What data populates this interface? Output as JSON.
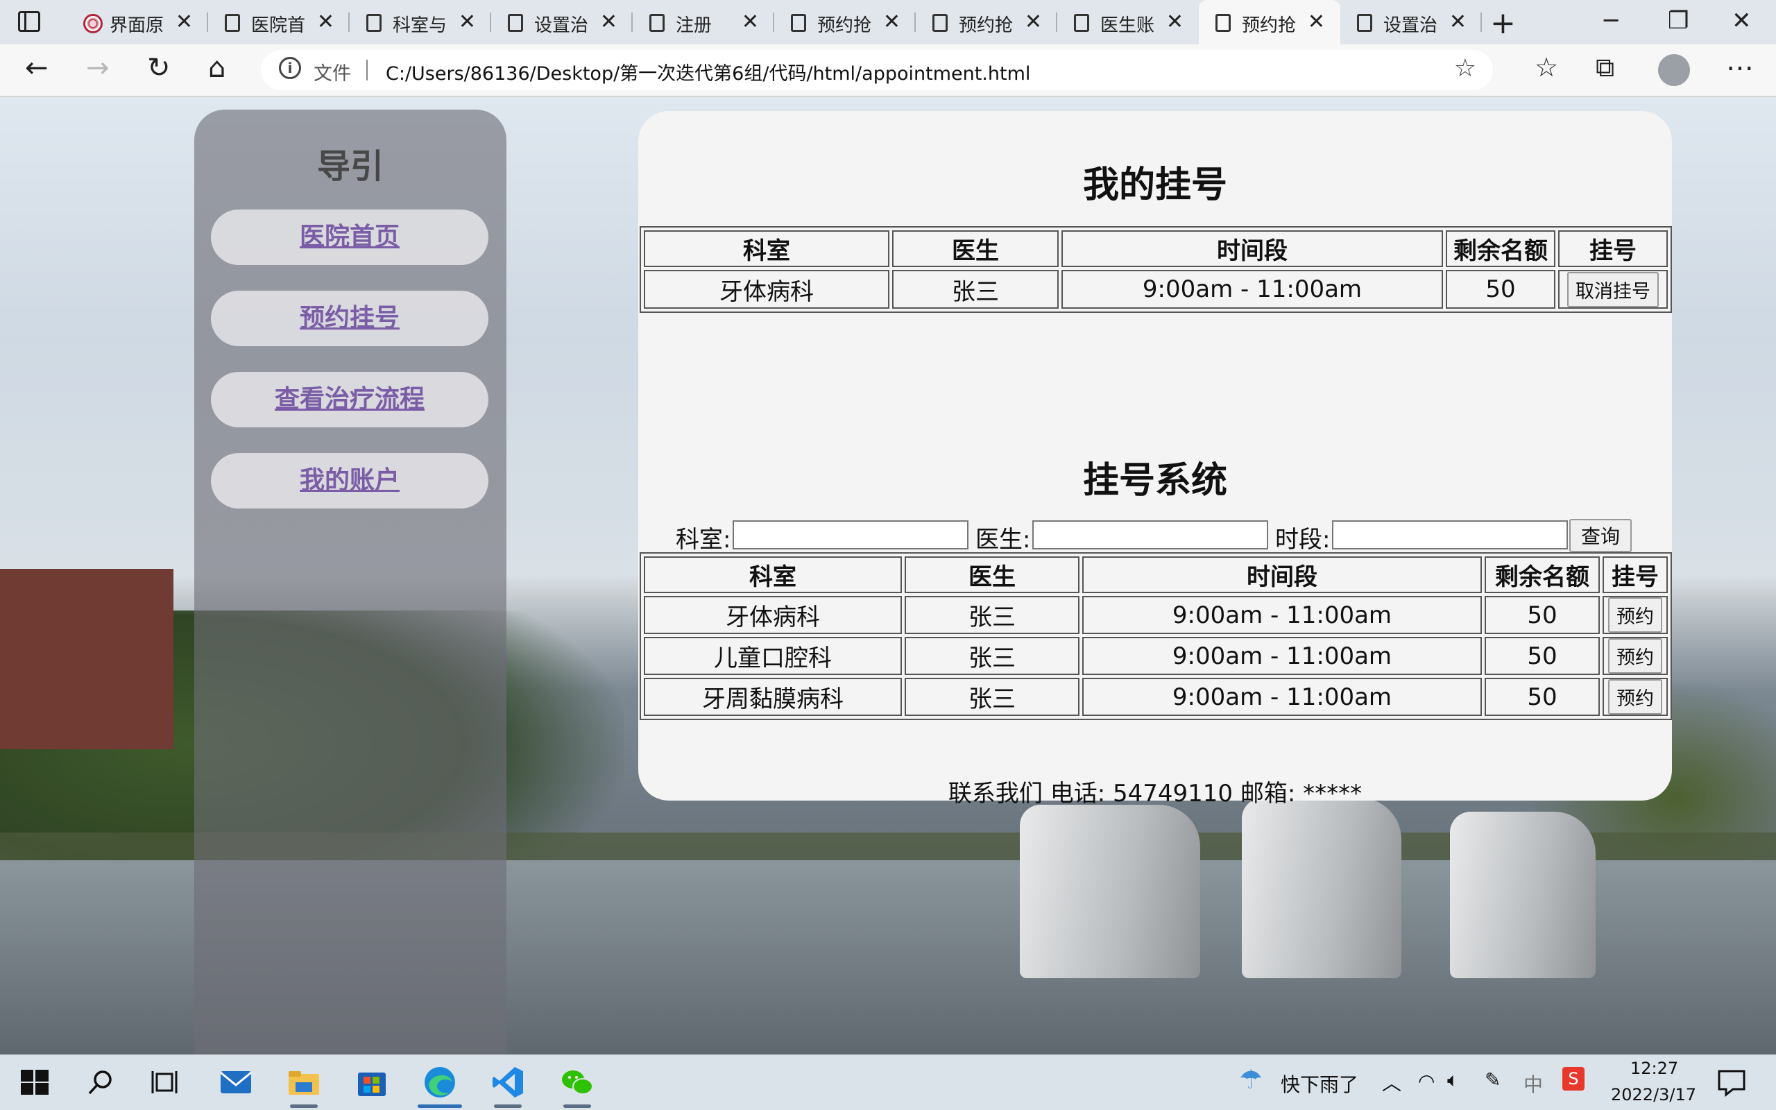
{
  "browser": {
    "tabs": [
      {
        "title": "界面原",
        "icon": "university-logo-icon"
      },
      {
        "title": "医院首",
        "icon": "document-icon"
      },
      {
        "title": "科室与",
        "icon": "document-icon"
      },
      {
        "title": "设置治",
        "icon": "document-icon"
      },
      {
        "title": "注册",
        "icon": "document-icon"
      },
      {
        "title": "预约抢",
        "icon": "document-icon"
      },
      {
        "title": "预约抢",
        "icon": "document-icon"
      },
      {
        "title": "医生账",
        "icon": "document-icon"
      },
      {
        "title": "预约抢",
        "icon": "document-icon",
        "active": true
      },
      {
        "title": "设置治",
        "icon": "document-icon"
      }
    ],
    "address": {
      "scheme_label": "文件",
      "url": "C:/Users/86136/Desktop/第一次迭代第6组/代码/html/appointment.html"
    }
  },
  "sidebar": {
    "title": "导引",
    "links": [
      "医院首页",
      "预约挂号",
      "查看治疗流程",
      "我的账户"
    ]
  },
  "my_registration": {
    "title": "我的挂号",
    "headers": [
      "科室",
      "医生",
      "时间段",
      "剩余名额",
      "挂号"
    ],
    "rows": [
      {
        "dept": "牙体病科",
        "doctor": "张三",
        "time": "9:00am - 11:00am",
        "remaining": "50",
        "action": "取消挂号"
      }
    ]
  },
  "registration_system": {
    "title": "挂号系统",
    "search": {
      "dept_label": "科室:",
      "doctor_label": "医生:",
      "period_label": "时段:",
      "dept_value": "",
      "doctor_value": "",
      "period_value": "",
      "query_label": "查询"
    },
    "headers": [
      "科室",
      "医生",
      "时间段",
      "剩余名额",
      "挂号"
    ],
    "rows": [
      {
        "dept": "牙体病科",
        "doctor": "张三",
        "time": "9:00am - 11:00am",
        "remaining": "50",
        "action": "预约"
      },
      {
        "dept": "儿童口腔科",
        "doctor": "张三",
        "time": "9:00am - 11:00am",
        "remaining": "50",
        "action": "预约"
      },
      {
        "dept": "牙周黏膜病科",
        "doctor": "张三",
        "time": "9:00am - 11:00am",
        "remaining": "50",
        "action": "预约"
      }
    ]
  },
  "footer": "联系我们 电话: 54749110 邮箱: *****",
  "taskbar": {
    "weather": "快下雨了",
    "ime": "中",
    "time": "12:27",
    "date": "2022/3/17"
  },
  "colors": {
    "link": "#7a5da6",
    "card_bg": "#f4f4f4",
    "sidebar_bg": "rgba(110,110,118,0.62)"
  }
}
